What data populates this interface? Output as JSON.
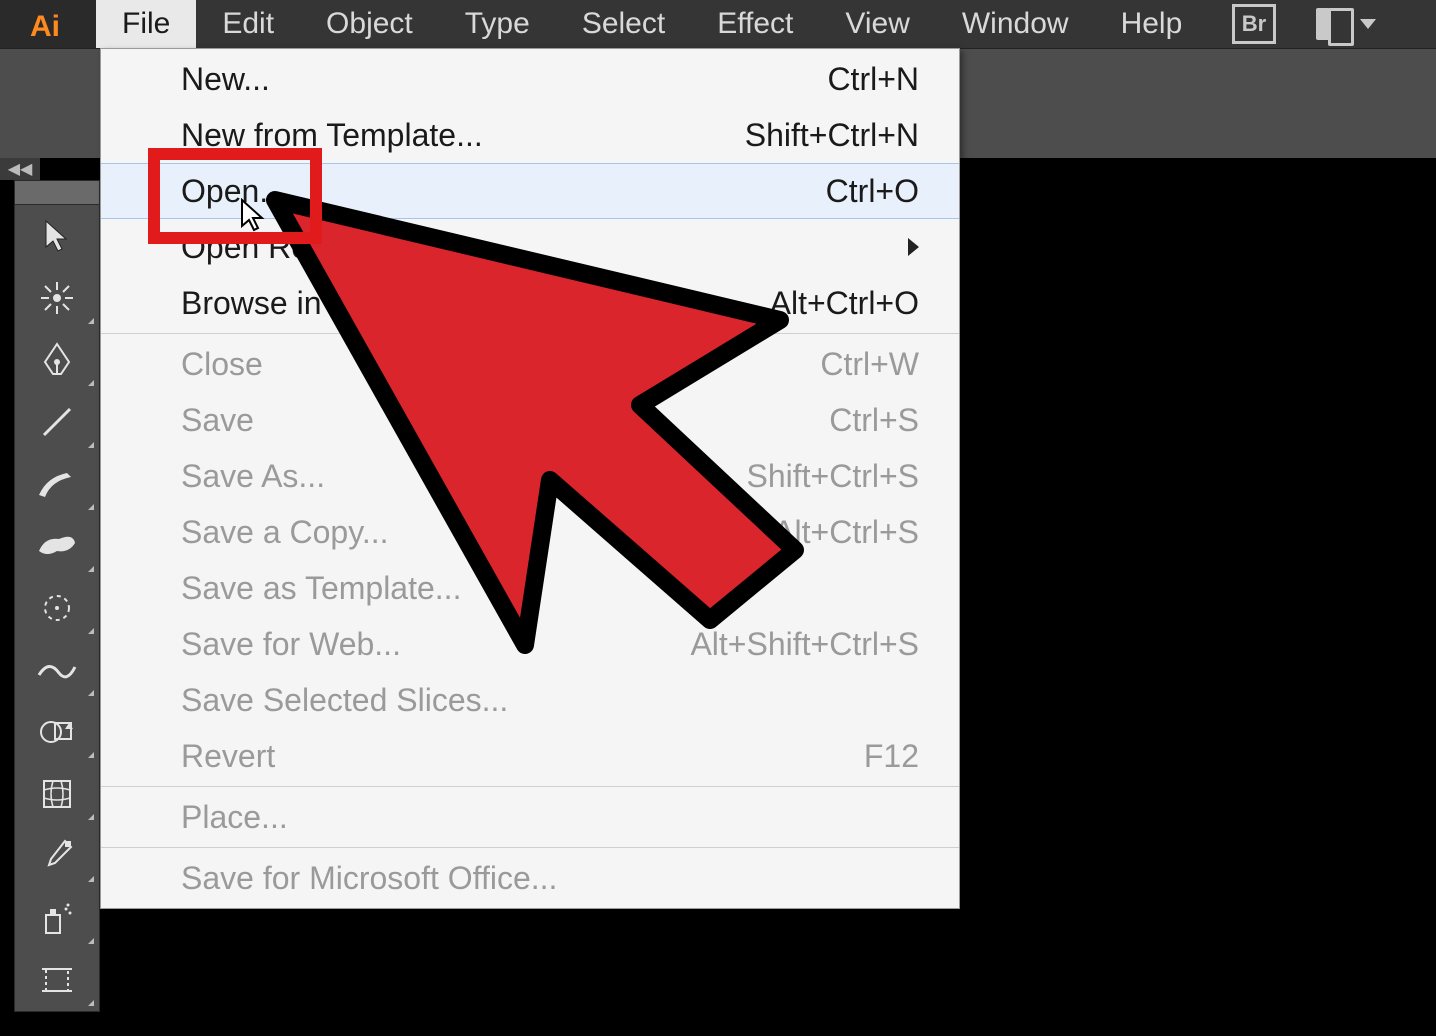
{
  "app": {
    "logo_text": "Ai",
    "bridge_badge": "Br"
  },
  "menubar": {
    "items": [
      {
        "label": "File",
        "active": true
      },
      {
        "label": "Edit"
      },
      {
        "label": "Object"
      },
      {
        "label": "Type"
      },
      {
        "label": "Select"
      },
      {
        "label": "Effect"
      },
      {
        "label": "View"
      },
      {
        "label": "Window"
      },
      {
        "label": "Help"
      }
    ]
  },
  "dropdown": {
    "group1": [
      {
        "label": "New...",
        "shortcut": "Ctrl+N"
      },
      {
        "label": "New from Template...",
        "shortcut": "Shift+Ctrl+N"
      },
      {
        "label": "Open...",
        "shortcut": "Ctrl+O",
        "highlight": true
      },
      {
        "label": "Open Recent Files",
        "submenu": true
      },
      {
        "label": "Browse in Bridge...",
        "shortcut": "Alt+Ctrl+O"
      }
    ],
    "group2": [
      {
        "label": "Close",
        "shortcut": "Ctrl+W",
        "disabled": true
      },
      {
        "label": "Save",
        "shortcut": "Ctrl+S",
        "disabled": true
      },
      {
        "label": "Save As...",
        "shortcut": "Shift+Ctrl+S",
        "disabled": true
      },
      {
        "label": "Save a Copy...",
        "shortcut": "Alt+Ctrl+S",
        "disabled": true
      },
      {
        "label": "Save as Template...",
        "disabled": true
      },
      {
        "label": "Save for Web...",
        "shortcut": "Alt+Shift+Ctrl+S",
        "disabled": true
      },
      {
        "label": "Save Selected Slices...",
        "disabled": true
      },
      {
        "label": "Revert",
        "shortcut": "F12",
        "disabled": true
      }
    ],
    "group3": [
      {
        "label": "Place...",
        "disabled": true
      }
    ],
    "group4": [
      {
        "label": "Save for Microsoft Office...",
        "disabled": true
      }
    ]
  },
  "toolbar": {
    "tools": [
      "selection-tool",
      "magic-wand-tool",
      "pen-tool",
      "line-segment-tool",
      "paintbrush-tool",
      "blob-brush-tool",
      "rotate-tool",
      "width-tool",
      "free-transform-tool",
      "mesh-tool",
      "eyedropper-tool",
      "symbol-sprayer-tool",
      "artboard-tool"
    ]
  }
}
